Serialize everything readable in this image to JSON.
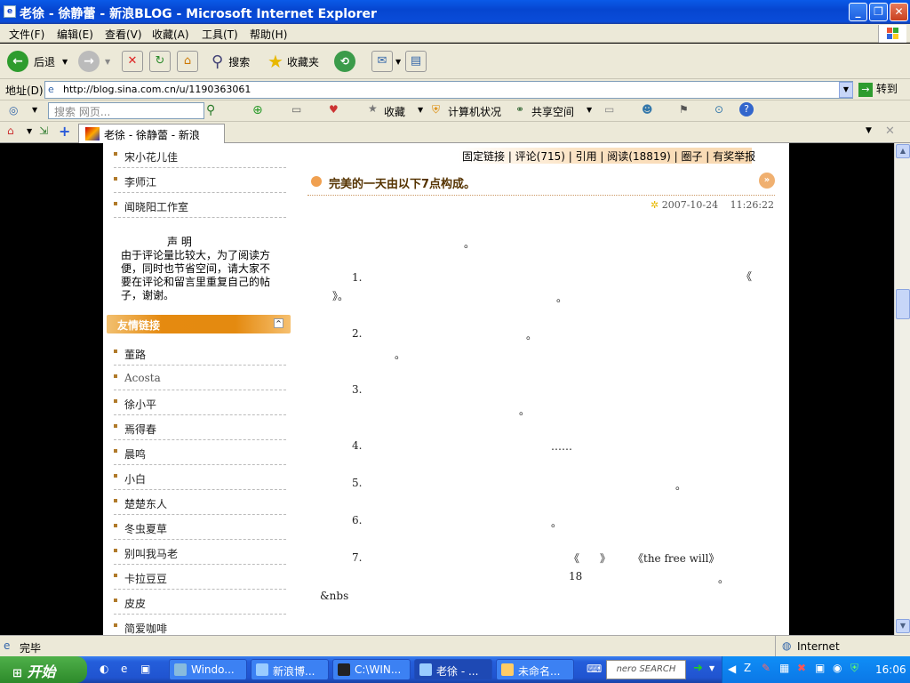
{
  "window": {
    "title": "老徐 - 徐静蕾 - 新浪BLOG - Microsoft Internet Explorer"
  },
  "menu": [
    "文件(F)",
    "编辑(E)",
    "查看(V)",
    "收藏(A)",
    "工具(T)",
    "帮助(H)"
  ],
  "toolbar": {
    "back": "后退",
    "search": "搜索",
    "favorites": "收藏夹"
  },
  "address": {
    "label": "地址(D)",
    "url": "http://blog.sina.com.cn/u/1190363061",
    "go": "转到"
  },
  "linksbar": {
    "search_placeholder": "搜索 网页...",
    "favorites": "收藏",
    "computer_status": "计算机状况",
    "share_space": "共享空间"
  },
  "tab": {
    "label": "老徐 - 徐静蕾 - 新浪BLOG"
  },
  "sidebar": {
    "top_links": [
      "宋小花儿佳",
      "李师江",
      "闻晓阳工作室"
    ],
    "notice_title": "声 明",
    "notice_body": "由于评论量比较大，为了阅读方便，同时也节省空间，请大家不要在评论和留言里重复自己的帖子，谢谢。",
    "friends_title": "友情链接",
    "friends": [
      "董路",
      "Acosta",
      "徐小平",
      "焉得春",
      "晨鸣",
      "小白",
      "楚楚东人",
      "冬虫夏草",
      "别叫我马老",
      "卡拉豆豆",
      "皮皮",
      "简爱咖啡"
    ]
  },
  "post": {
    "links": "固定链接 | 评论(715) | 引用 | 阅读(18819) | 圈子 | 有奖举报",
    "title": "完美的一天由以下7点构成。",
    "date": "2007-10-24",
    "time": "11:26:22",
    "body": [
      "。",
      "1.",
      "《",
      "》。",
      "。",
      "2.",
      "。",
      "。",
      "3.",
      "。",
      "4.",
      "……",
      "5.",
      "。",
      "6.",
      "。",
      "7.",
      "《",
      "》",
      "《the free will》",
      "18",
      "。",
      "&nbs"
    ]
  },
  "status": {
    "text": "完毕",
    "zone": "Internet"
  },
  "taskbar": {
    "start": "开始",
    "tasks": [
      "Windo...",
      "新浪博...",
      "C:\\WIN...",
      "老徐 - ...",
      "未命名..."
    ],
    "nero": "nero SEARCH",
    "clock": "16:06"
  }
}
